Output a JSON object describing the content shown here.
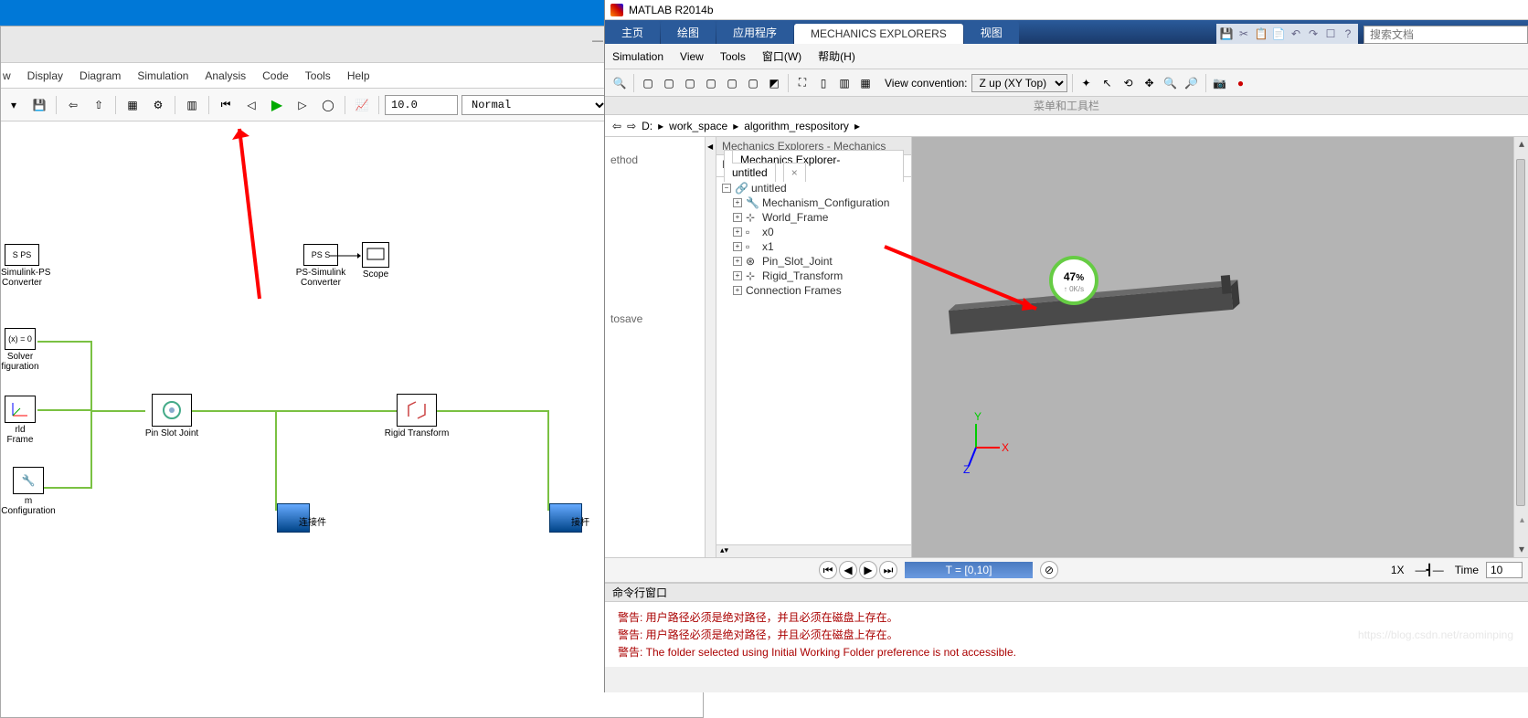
{
  "simulink": {
    "menus": [
      "w",
      "Display",
      "Diagram",
      "Simulation",
      "Analysis",
      "Code",
      "Tools",
      "Help"
    ],
    "stop_time": "10.0",
    "mode": "Normal",
    "blocks": {
      "simps": {
        "label": "Simulink-PS\nConverter",
        "text": "S PS"
      },
      "pssim": {
        "label": "PS-Simulink\nConverter",
        "text": "PS S"
      },
      "scope": {
        "label": "Scope"
      },
      "solver": {
        "label": "Solver\nfiguration",
        "text": "(x) = 0"
      },
      "world": {
        "label": "rld Frame"
      },
      "mech": {
        "label": "m Configuration"
      },
      "pin": {
        "label": "Pin Slot Joint"
      },
      "rigid": {
        "label": "Rigid Transform"
      },
      "sub1": {
        "label": "连接件"
      },
      "sub2": {
        "label": "接杆"
      }
    }
  },
  "matlab": {
    "title": "MATLAB R2014b",
    "tabs": [
      "主页",
      "绘图",
      "应用程序",
      "MECHANICS EXPLORERS",
      "视图"
    ],
    "active_tab": 3,
    "search_ph": "搜索文档",
    "menu2": [
      "Simulation",
      "View",
      "Tools",
      "窗口(W)",
      "帮助(H)"
    ],
    "view_conv_label": "View convention:",
    "view_conv_value": "Z up (XY Top)",
    "strip": "菜单和工具栏",
    "crumbs": [
      "D:",
      "work_space",
      "algorithm_respository"
    ],
    "tree_title": "Mechanics Explorers - Mechanics Explorer-untitled",
    "tree_tab": "Mechanics Explorer-untitled",
    "tree": [
      {
        "n": "untitled",
        "root": true
      },
      {
        "n": "Mechanism_Configuration"
      },
      {
        "n": "World_Frame"
      },
      {
        "n": "x0"
      },
      {
        "n": "x1"
      },
      {
        "n": "Pin_Slot_Joint"
      },
      {
        "n": "Rigid_Transform"
      },
      {
        "n": "Connection Frames"
      }
    ],
    "left_hints": [
      "ethod",
      "tosave"
    ],
    "progress": {
      "pct": "47",
      "unit": "%",
      "rate": "↑ 0K/s"
    },
    "play": {
      "label": "T = [0,10]",
      "speed": "1X",
      "time_lbl": "Time",
      "time": "10"
    },
    "cmd_title": "命令行窗口",
    "cmd_lines": [
      "警告: 用户路径必须是绝对路径，并且必须在磁盘上存在。",
      "警告: 用户路径必须是绝对路径，并且必须在磁盘上存在。",
      "警告: The folder selected using Initial Working Folder preference is not accessible."
    ]
  },
  "watermark": "https://blog.csdn.net/raominping"
}
